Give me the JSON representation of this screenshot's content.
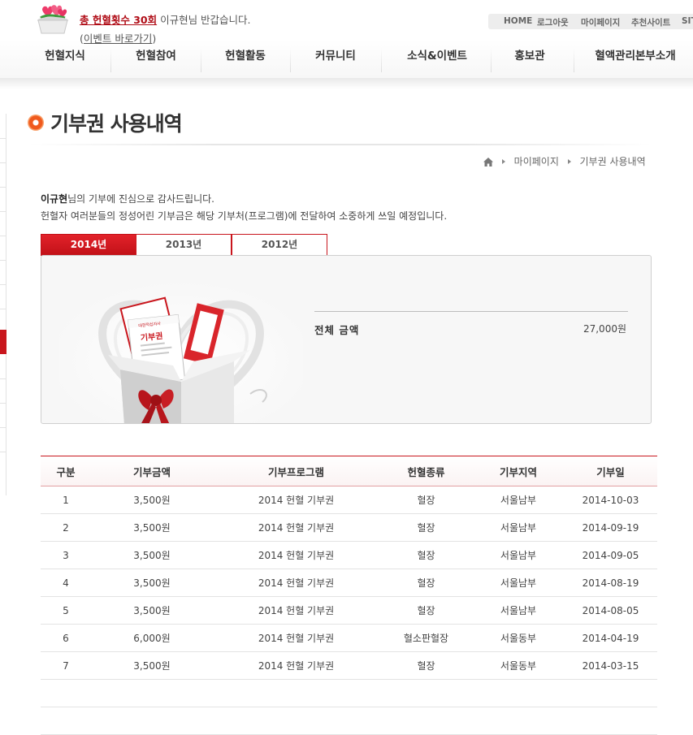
{
  "header": {
    "welcome_count": "총 헌혈횟수 30회",
    "welcome_text": " 이규현님 반갑습니다.",
    "event_open": "(",
    "event_link": "이벤트 바로가기",
    "event_close": ")"
  },
  "util_nav": [
    "HOME",
    "로그아웃",
    "마이페이지",
    "추천사이트",
    "SITE"
  ],
  "gnb": [
    "헌혈지식",
    "헌혈참여",
    "헌혈활동",
    "커뮤니티",
    "소식&이벤트",
    "홍보관",
    "혈액관리본부소개"
  ],
  "page": {
    "title": "기부권 사용내역",
    "breadcrumb": [
      "마이페이지",
      "기부권 사용내역"
    ],
    "intro_name": "이규현",
    "intro_line1_rest": "님의 기부에 진심으로 감사드립니다.",
    "intro_line2": "헌혈자 여러분들의 정성어린 기부금은 해당 기부처(프로그램)에 전달하여 소중하게 쓰일 예정입니다."
  },
  "tabs": [
    {
      "label": "2014년",
      "active": true
    },
    {
      "label": "2013년",
      "active": false
    },
    {
      "label": "2012년",
      "active": false
    }
  ],
  "summary": {
    "total_label": "전체 금액",
    "total_value": "27,000원",
    "voucher_text": "기부권",
    "voucher_brand": "대한적십자사"
  },
  "table": {
    "headers": [
      "구분",
      "기부금액",
      "기부프로그램",
      "헌혈종류",
      "기부지역",
      "기부일"
    ],
    "rows": [
      [
        "1",
        "3,500원",
        "2014 헌혈 기부권",
        "혈장",
        "서울남부",
        "2014-10-03"
      ],
      [
        "2",
        "3,500원",
        "2014 헌혈 기부권",
        "혈장",
        "서울남부",
        "2014-09-19"
      ],
      [
        "3",
        "3,500원",
        "2014 헌혈 기부권",
        "혈장",
        "서울남부",
        "2014-09-05"
      ],
      [
        "4",
        "3,500원",
        "2014 헌혈 기부권",
        "혈장",
        "서울남부",
        "2014-08-19"
      ],
      [
        "5",
        "3,500원",
        "2014 헌혈 기부권",
        "혈장",
        "서울남부",
        "2014-08-05"
      ],
      [
        "6",
        "6,000원",
        "2014 헌혈 기부권",
        "혈소판혈장",
        "서울동부",
        "2014-04-19"
      ],
      [
        "7",
        "3,500원",
        "2014 헌혈 기부권",
        "혈장",
        "서울동부",
        "2014-03-15"
      ]
    ]
  },
  "colors": {
    "accent": "#c9161d",
    "title_icon": "#f05a1e"
  }
}
